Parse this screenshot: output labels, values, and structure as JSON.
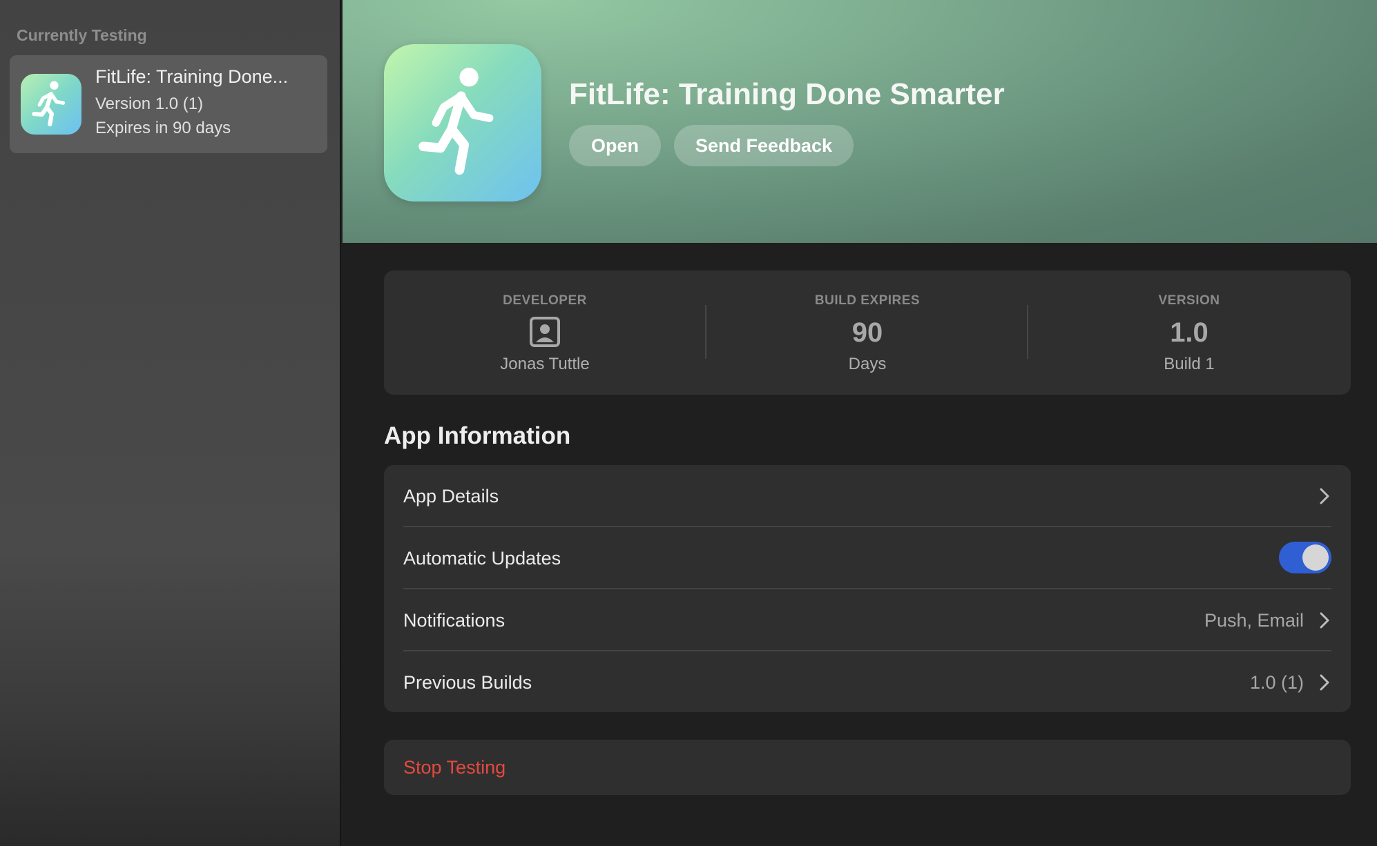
{
  "sidebar": {
    "heading": "Currently Testing",
    "items": [
      {
        "app_name": "FitLife: Training Done...",
        "version": "Version 1.0 (1)",
        "expires": "Expires in 90 days",
        "icon": "running-person-icon"
      }
    ]
  },
  "hero": {
    "title": "FitLife: Training Done Smarter",
    "icon": "running-person-icon",
    "open_label": "Open",
    "feedback_label": "Send Feedback"
  },
  "info": {
    "developer": {
      "label": "DEVELOPER",
      "icon": "person-badge-icon",
      "name": "Jonas Tuttle"
    },
    "build_expires": {
      "label": "BUILD EXPIRES",
      "value": "90",
      "unit": "Days"
    },
    "version": {
      "label": "VERSION",
      "value": "1.0",
      "build": "Build 1"
    }
  },
  "app_information": {
    "title": "App Information",
    "rows": [
      {
        "label": "App Details",
        "value": ""
      },
      {
        "label": "Automatic Updates",
        "toggle_on": true
      },
      {
        "label": "Notifications",
        "value": "Push, Email"
      },
      {
        "label": "Previous Builds",
        "value": "1.0 (1)"
      }
    ]
  },
  "stop_testing": {
    "label": "Stop Testing"
  },
  "colors": {
    "accent_toggle": "#2f5fd2",
    "destructive": "#e5493f",
    "hero_green": "#7fae91"
  }
}
